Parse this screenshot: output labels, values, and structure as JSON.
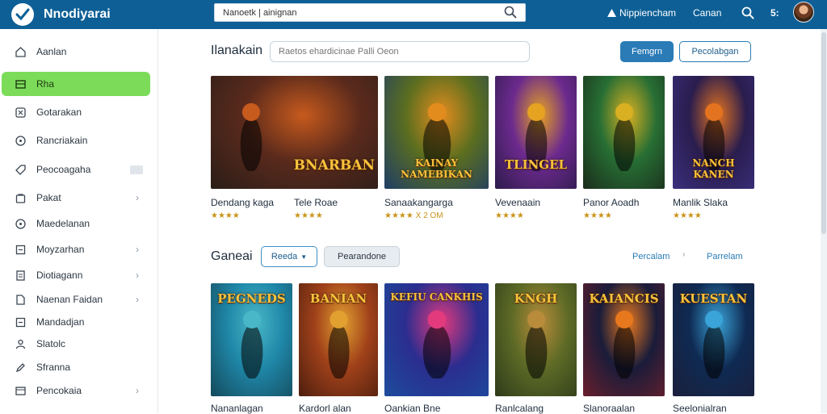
{
  "app": {
    "title": "Nnodiyarai"
  },
  "search": {
    "value": "Nanoetk | ainignan"
  },
  "top_right": {
    "link1": "Nippiencham",
    "link2": "Canan",
    "count": "5:"
  },
  "sidebar": {
    "items": [
      {
        "label": "Aanlan",
        "icon": "home-icon"
      },
      {
        "label": "Rha",
        "icon": "grid-icon",
        "active": true
      },
      {
        "label": "Gotarakan",
        "icon": "box-x-icon"
      },
      {
        "label": "Rancriakain",
        "icon": "circle-icon"
      },
      {
        "label": "Peocoagaha",
        "icon": "tag-icon",
        "badge": true
      },
      {
        "label": "Pakat",
        "icon": "bag-icon",
        "chevron": true
      },
      {
        "label": "Maedelanan",
        "icon": "circle-icon"
      },
      {
        "label": "Moyzarhan",
        "icon": "square-icon",
        "chevron": true
      },
      {
        "label": "Diotiagann",
        "icon": "doc-icon",
        "chevron": true
      },
      {
        "label": "Naenan Faidan",
        "icon": "file-icon",
        "chevron": true
      },
      {
        "label": "Mandadjan",
        "icon": "square-icon"
      },
      {
        "label": "Slatolc",
        "icon": "users-icon"
      },
      {
        "label": "Sfranna",
        "icon": "edit-icon"
      },
      {
        "label": "Pencokaia",
        "icon": "box-icon",
        "chevron": true
      }
    ]
  },
  "section1": {
    "title": "Ilanakain",
    "filter_placeholder": "Raetos ehardicinae Palli Oeon",
    "btn_primary": "Femgrn",
    "btn_outline": "Pecolabgan",
    "games": [
      {
        "name": "Dendang kaga",
        "rating": "★★★★",
        "art": "BNARBAN",
        "colors": [
          "#5a2a1c",
          "#c75a1d",
          "#2a1d18"
        ]
      },
      {
        "name": "Tele Roae",
        "rating": "★★★★",
        "art": "",
        "colors": [
          "#3c4a28",
          "#8f7b3b",
          "#232a18"
        ]
      },
      {
        "name": "Sanaakangarga",
        "rating": "★★★★ X 2 OM",
        "art": "KAINAY NAMEBIKAN",
        "colors": [
          "#5b6e1f",
          "#e38c1e",
          "#1e3d66"
        ]
      },
      {
        "name": "Vevenaain",
        "rating": "★★★★",
        "art": "TLINGEL",
        "colors": [
          "#6c2a8e",
          "#e6a221",
          "#2d1b4a"
        ]
      },
      {
        "name": "Panor Aoadh",
        "rating": "★★★★",
        "art": "",
        "colors": [
          "#276e34",
          "#d9b021",
          "#1a2c1a"
        ]
      },
      {
        "name": "Manlik Slaka",
        "rating": "★★★★",
        "art": "NANCH KANEN",
        "colors": [
          "#2a1d4e",
          "#e4731f",
          "#3a2f7e"
        ]
      }
    ]
  },
  "section2": {
    "title": "Ganeai",
    "dropdown": "Reeda",
    "btn_gray": "Pearandone",
    "link1": "Percalam",
    "link2": "Parrelam",
    "games": [
      {
        "name": "Nananlagan",
        "art": "PEGNEDS",
        "colors": [
          "#1f87a8",
          "#49b7c7",
          "#14495b"
        ]
      },
      {
        "name": "Kardorl alan",
        "art": "BANIAN",
        "colors": [
          "#a0411a",
          "#e2a030",
          "#4d1e0e"
        ]
      },
      {
        "name": "Oankian Bne",
        "art": "KEFIU CANKHIS",
        "colors": [
          "#2b2d8f",
          "#e23a7d",
          "#1c4c9c"
        ]
      },
      {
        "name": "Ranlcalang",
        "art": "KNGH",
        "colors": [
          "#5d6a26",
          "#b88c3a",
          "#2e3b1a"
        ]
      },
      {
        "name": "Slanoraalan",
        "art": "KAIANCIS",
        "colors": [
          "#1a1c3a",
          "#e8781e",
          "#6a1f2c"
        ]
      },
      {
        "name": "Seelonialran",
        "art": "KUESTAN",
        "colors": [
          "#0f2a52",
          "#3aa3d8",
          "#1b1f3c"
        ]
      }
    ]
  }
}
